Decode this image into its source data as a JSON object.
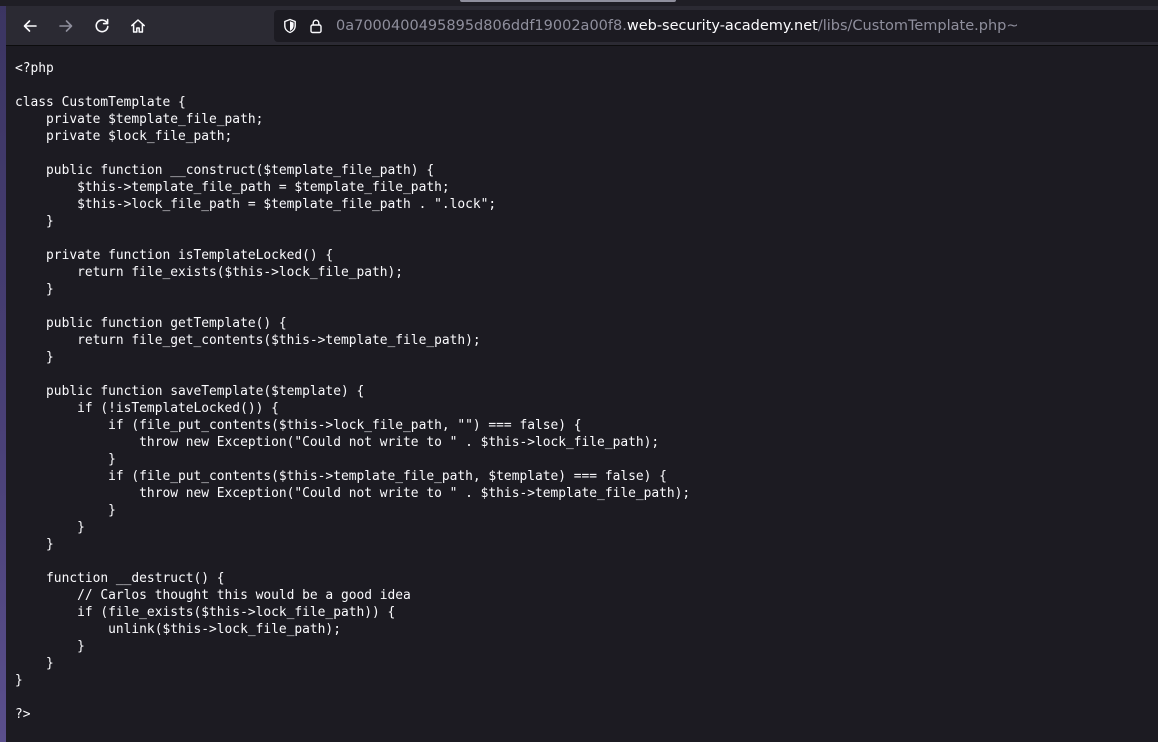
{
  "toolbar": {
    "back_icon": "arrow-left-icon",
    "forward_icon": "arrow-right-icon",
    "reload_icon": "reload-icon",
    "home_icon": "home-icon"
  },
  "urlbar": {
    "tracking_icon": "shield-icon",
    "security_icon": "lock-icon",
    "url_prefix": "0a7000400495895d806ddf19002a00f8.",
    "url_domain": "web-security-academy.net",
    "url_path": "/libs/CustomTemplate.php~"
  },
  "colors": {
    "toolbar_bg": "#2b2a33",
    "page_bg": "#1c1b22",
    "text": "#fbfbfe",
    "url_dim": "#8f8f9d"
  },
  "document": {
    "source": "<?php\n\nclass CustomTemplate {\n    private $template_file_path;\n    private $lock_file_path;\n\n    public function __construct($template_file_path) {\n        $this->template_file_path = $template_file_path;\n        $this->lock_file_path = $template_file_path . \".lock\";\n    }\n\n    private function isTemplateLocked() {\n        return file_exists($this->lock_file_path);\n    }\n\n    public function getTemplate() {\n        return file_get_contents($this->template_file_path);\n    }\n\n    public function saveTemplate($template) {\n        if (!isTemplateLocked()) {\n            if (file_put_contents($this->lock_file_path, \"\") === false) {\n                throw new Exception(\"Could not write to \" . $this->lock_file_path);\n            }\n            if (file_put_contents($this->template_file_path, $template) === false) {\n                throw new Exception(\"Could not write to \" . $this->template_file_path);\n            }\n        }\n    }\n\n    function __destruct() {\n        // Carlos thought this would be a good idea\n        if (file_exists($this->lock_file_path)) {\n            unlink($this->lock_file_path);\n        }\n    }\n}\n\n?>"
  }
}
